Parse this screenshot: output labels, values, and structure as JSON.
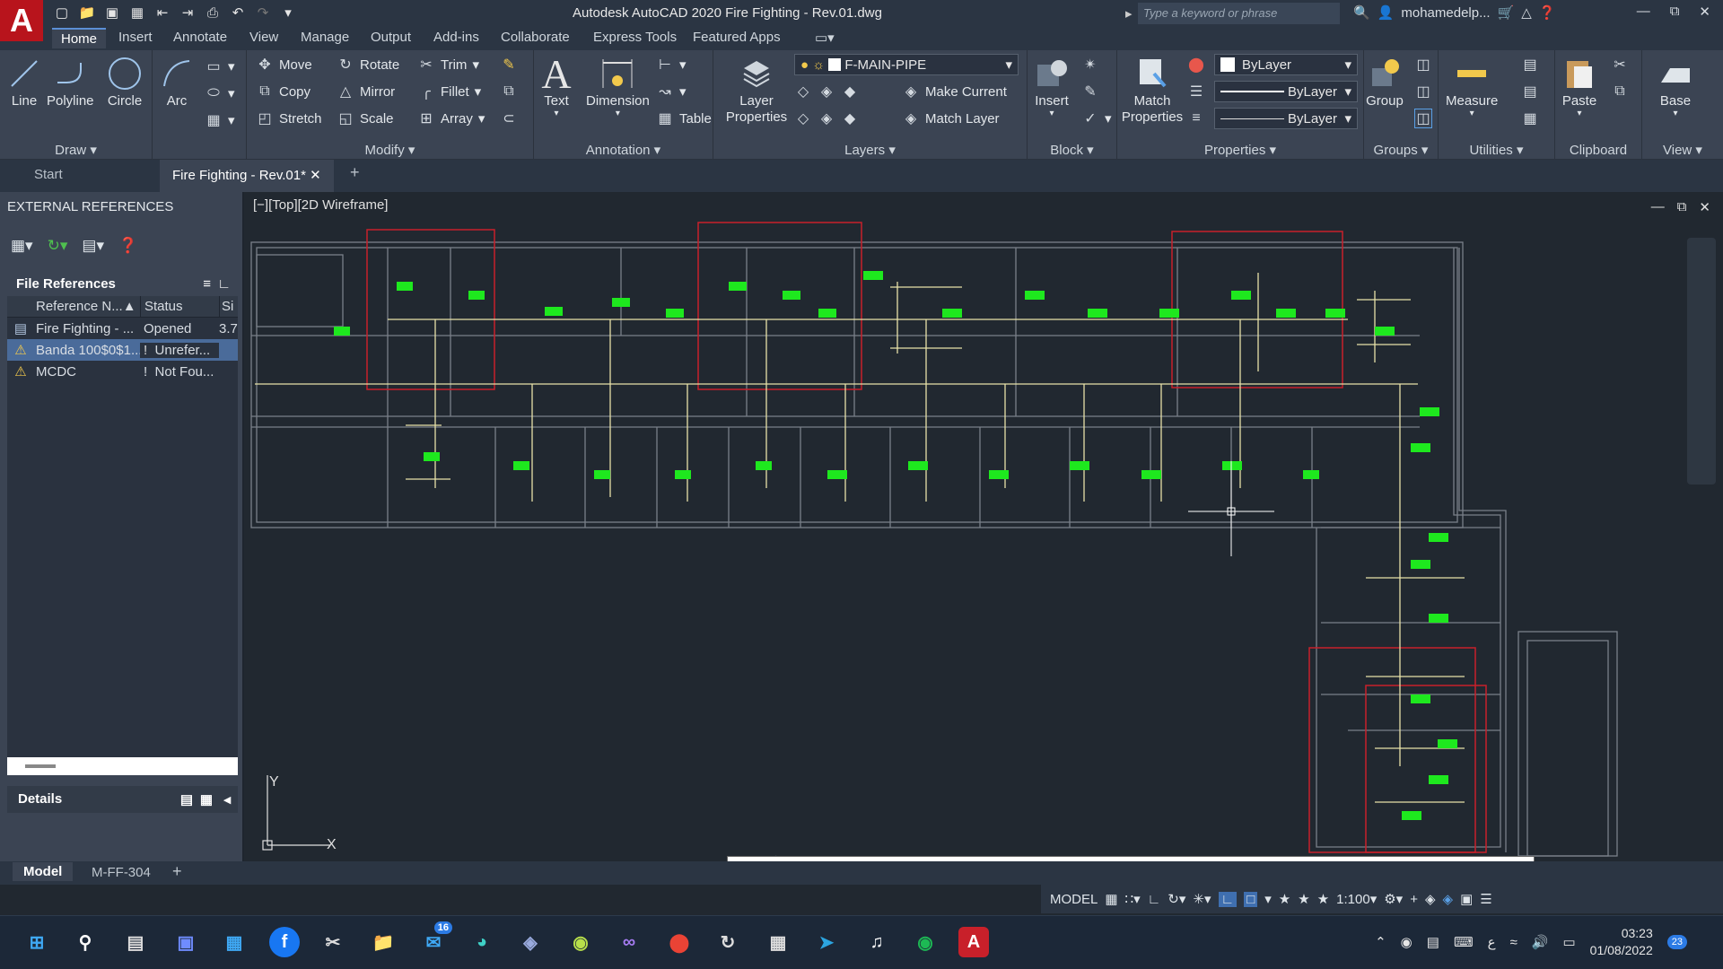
{
  "app": {
    "title": "Autodesk AutoCAD 2020   Fire Fighting - Rev.01.dwg",
    "logo_letter": "A",
    "search_placeholder": "Type a keyword or phrase",
    "user": "mohamedelp...",
    "accent": "#b8141c"
  },
  "ribbon_tabs": [
    "Home",
    "Insert",
    "Annotate",
    "View",
    "Manage",
    "Output",
    "Add-ins",
    "Collaborate",
    "Express Tools",
    "Featured Apps"
  ],
  "draw": {
    "title": "Draw",
    "line": "Line",
    "polyline": "Polyline",
    "circle": "Circle",
    "arc": "Arc"
  },
  "modify": {
    "title": "Modify",
    "move": "Move",
    "rotate": "Rotate",
    "trim": "Trim",
    "copy": "Copy",
    "mirror": "Mirror",
    "fillet": "Fillet",
    "stretch": "Stretch",
    "scale": "Scale",
    "array": "Array"
  },
  "annotation": {
    "title": "Annotation",
    "text": "Text",
    "dimension": "Dimension",
    "table": "Table"
  },
  "layers": {
    "title": "Layers",
    "layer_properties": "Layer Properties",
    "current_layer": "F-MAIN-PIPE",
    "make_current": "Make Current",
    "match_layer": "Match Layer"
  },
  "block": {
    "title": "Block",
    "insert": "Insert"
  },
  "properties": {
    "title": "Properties",
    "match_properties": "Match Properties",
    "color": "ByLayer",
    "linetype": "ByLayer",
    "lineweight": "ByLayer"
  },
  "groups": {
    "title": "Groups",
    "group": "Group"
  },
  "utilities": {
    "title": "Utilities",
    "measure": "Measure"
  },
  "clipboard": {
    "title": "Clipboard",
    "paste": "Paste"
  },
  "view": {
    "title": "View",
    "base": "Base"
  },
  "doc_tabs": {
    "start": "Start",
    "active": "Fire Fighting - Rev.01*"
  },
  "xref": {
    "title": "EXTERNAL REFERENCES",
    "file_refs": "File References",
    "col_name": "Reference N...",
    "col_status": "Status",
    "col_size": "Si",
    "rows": [
      {
        "name": "Fire Fighting - ...",
        "status": "Opened",
        "size": "3.7"
      },
      {
        "name": "Banda 100$0$1...",
        "status": "Unrefer...",
        "size": ""
      },
      {
        "name": "MCDC",
        "status": "Not Fou...",
        "size": ""
      }
    ],
    "details": "Details"
  },
  "viewport": {
    "label": "[−][Top][2D Wireframe]",
    "ucs_x": "X",
    "ucs_y": "Y"
  },
  "layout_tabs": {
    "model": "Model",
    "layout1": "M-FF-304"
  },
  "status": {
    "model": "MODEL",
    "scale": "1:100"
  },
  "taskbar": {
    "time": "03:23",
    "date": "01/08/2022",
    "mail_badge": "16",
    "notif_badge": "23",
    "lang": "ع"
  }
}
